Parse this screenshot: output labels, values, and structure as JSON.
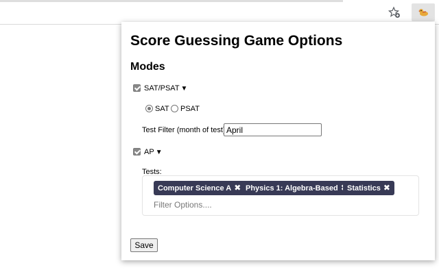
{
  "browser": {
    "bookmark_icon": "star-plus-icon",
    "extension_icon": "duck-icon"
  },
  "popup": {
    "title": "Score Guessing Game Options",
    "modes_heading": "Modes",
    "sat_mode": {
      "label": "SAT/PSAT",
      "caret": "▼",
      "checked": true,
      "radio_options": [
        "SAT",
        "PSAT"
      ],
      "selected": "SAT",
      "filter_label": "Test Filter (month of test):",
      "filter_value": "April"
    },
    "ap_mode": {
      "label": "AP",
      "caret": "▼",
      "checked": true,
      "tests_label": "Tests:",
      "tests": [
        "Computer Science A",
        "Physics 1: Algebra-Based",
        "Statistics"
      ],
      "remove_glyph": "✖",
      "filter_placeholder": "Filter Options...."
    },
    "save_label": "Save"
  },
  "colors": {
    "tag_bg": "#383a56",
    "accent": "#e8a93a"
  }
}
